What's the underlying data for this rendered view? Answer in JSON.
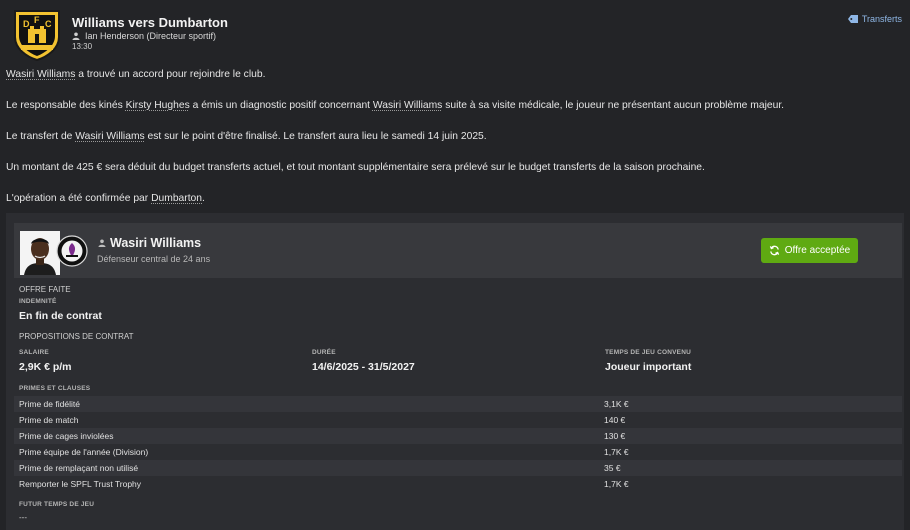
{
  "header": {
    "title": "Williams vers Dumbarton",
    "sender": "Ian Henderson  (Directeur sportif)",
    "time": "13:30",
    "transfers_link": "Transferts",
    "crest_text": "DUMBARTON F.C."
  },
  "message": {
    "p1": {
      "pre": "",
      "name": "Wasiri Williams",
      "post": " a trouvé un accord pour rejoindre le club."
    },
    "p2": {
      "a": "Le responsable des kinés ",
      "b": "Kirsty Hughes",
      "c": " a émis un diagnostic positif concernant ",
      "d": "Wasiri Williams",
      "e": " suite à sa visite médicale, le joueur ne présentant aucun problème majeur."
    },
    "p3": {
      "a": "Le transfert de ",
      "b": "Wasiri Williams",
      "c": " est sur le point d'être finalisé. Le transfert aura lieu le samedi 14 juin 2025."
    },
    "p4": "Un montant de 425 € sera déduit du budget transferts actuel, et tout montant supplémentaire sera prélevé sur le budget transferts de la saison prochaine.",
    "p5": {
      "a": "L'opération a été confirmée par ",
      "b": "Dumbarton",
      "c": "."
    }
  },
  "player": {
    "name": "Wasiri Williams",
    "position": "Défenseur central de 24 ans",
    "status_button": "Offre acceptée"
  },
  "offer": {
    "section_label": "OFFRE FAITE",
    "fee_label": "INDEMNITÉ",
    "fee_value": "En fin de contrat",
    "contract_label": "PROPOSITIONS DE CONTRAT",
    "salary_label": "SALAIRE",
    "salary_value": "2,9K € p/m",
    "duration_label": "DURÉE",
    "duration_value": "14/6/2025 - 31/5/2027",
    "playing_time_label": "TEMPS DE JEU CONVENU",
    "playing_time_value": "Joueur important",
    "bonuses_label": "PRIMES ET CLAUSES",
    "bonuses": [
      {
        "label": "Prime de fidélité",
        "value": "3,1K €"
      },
      {
        "label": "Prime de match",
        "value": "140 €"
      },
      {
        "label": "Prime de cages inviolées",
        "value": "130 €"
      },
      {
        "label": "Prime équipe de l'année (Division)",
        "value": "1,7K €"
      },
      {
        "label": "Prime de remplaçant non utilisé",
        "value": "35 €"
      },
      {
        "label": "Remporter le SPFL Trust Trophy",
        "value": "1,7K €"
      }
    ],
    "future_label": "FUTUR TEMPS DE JEU",
    "future_value": "---"
  },
  "colors": {
    "background": "#232427",
    "panel": "#2c2d31",
    "accent_green": "#5faa12",
    "link_blue": "#8fb7e6",
    "crest_gold": "#f2c230"
  }
}
